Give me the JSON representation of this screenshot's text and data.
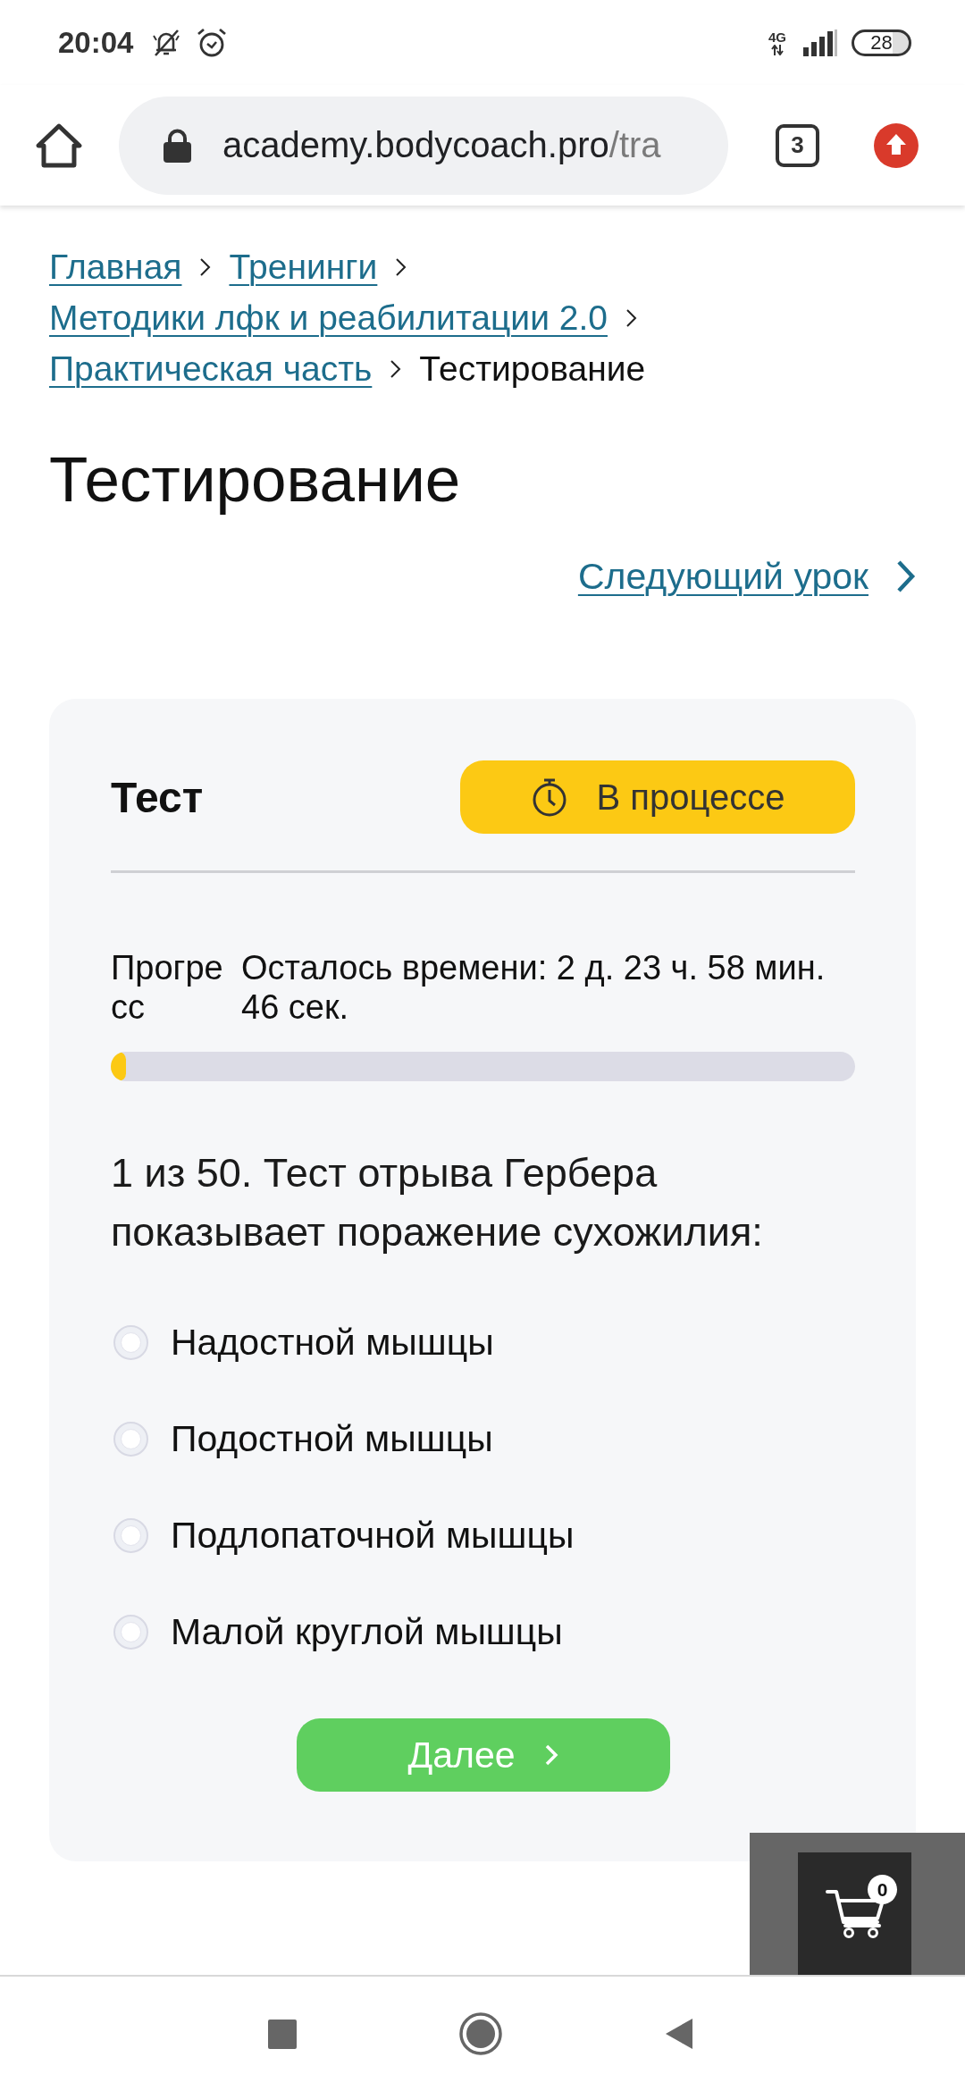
{
  "status_bar": {
    "time": "20:04",
    "network": "4G",
    "battery": "28"
  },
  "browser": {
    "url_host": "academy.bodycoach.pro",
    "url_path": "/tra",
    "tab_count": "3"
  },
  "breadcrumbs": [
    {
      "label": "Главная",
      "current": false
    },
    {
      "label": "Тренинги",
      "current": false
    },
    {
      "label": "Методики лфк и реабилитации 2.0",
      "current": false
    },
    {
      "label": "Практическая часть",
      "current": false
    },
    {
      "label": "Тестирование",
      "current": true
    }
  ],
  "page": {
    "title": "Тестирование",
    "next_lesson": "Следующий урок"
  },
  "test_card": {
    "title": "Тест",
    "status": "В процессе",
    "progress_label": "Прогресс",
    "time_left": "Осталось времени: 2 д. 23 ч. 58 мин. 46 сек.",
    "progress": {
      "level": 0.02
    },
    "question": "1 из 50. Тест отрыва Гербера показывает поражение сухожилия:",
    "options": [
      {
        "label": "Надостной мышцы",
        "selected": false
      },
      {
        "label": "Подостной мышцы",
        "selected": false
      },
      {
        "label": "Подлопаточной мышцы",
        "selected": false
      },
      {
        "label": "Малой круглой мышцы",
        "selected": false
      }
    ],
    "next_button": "Далее"
  },
  "cart": {
    "count": "0"
  }
}
